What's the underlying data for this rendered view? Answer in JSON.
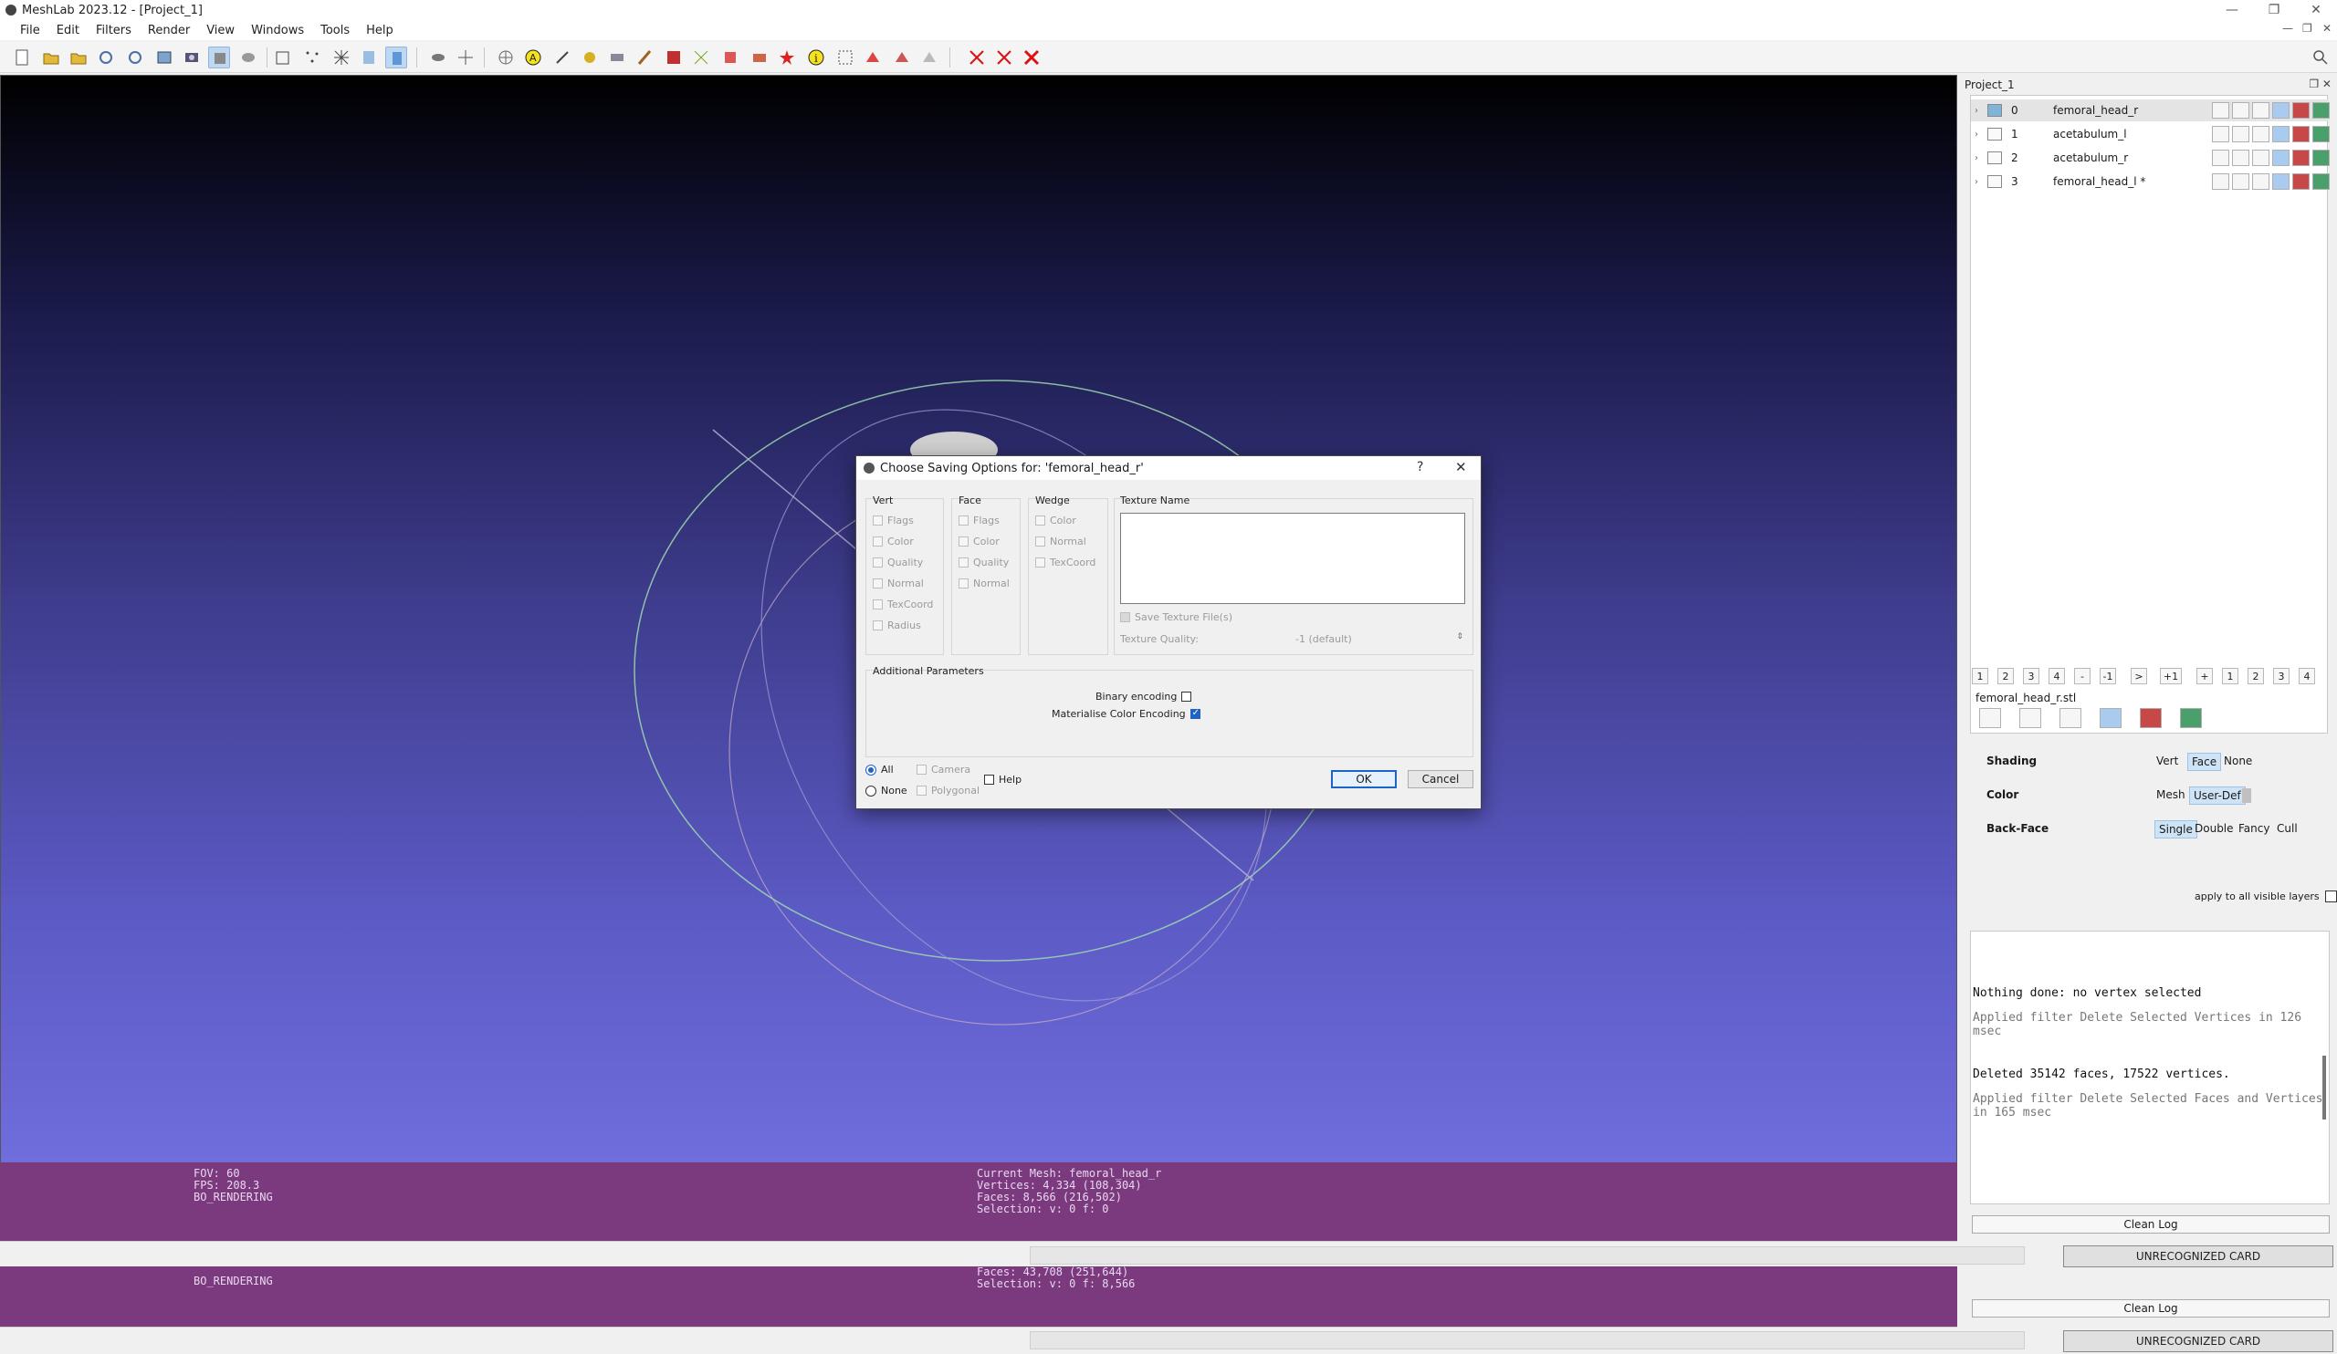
{
  "window": {
    "title": "MeshLab 2023.12 - [Project_1]"
  },
  "menu": [
    "File",
    "Edit",
    "Filters",
    "Render",
    "View",
    "Windows",
    "Tools",
    "Help"
  ],
  "viewport": {
    "left_info": [
      "FOV: 60",
      "FPS:   208.3",
      "BO_RENDERING"
    ],
    "right_info": [
      "Current Mesh: femoral_head_r",
      "Vertices: 4,334    (108,304)",
      "Faces: 8,566    (216,502)",
      "Selection: v: 0 f: 0"
    ],
    "left_info2": [
      "BO_RENDERING"
    ],
    "right_info2": [
      "Faces: 43,708    (251,644)",
      "Selection: v: 0 f: 8,566"
    ],
    "card_button": "UNRECOGNIZED CARD"
  },
  "dock": {
    "title": "Project_1",
    "layers": [
      {
        "index": "0",
        "name": "femoral_head_r",
        "selected": true
      },
      {
        "index": "1",
        "name": "acetabulum_l",
        "selected": false
      },
      {
        "index": "2",
        "name": "acetabulum_r",
        "selected": false
      },
      {
        "index": "3",
        "name": "femoral_head_l *",
        "selected": false
      }
    ],
    "number_buttons": [
      "1",
      "2",
      "3",
      "4",
      "-",
      "-1",
      ">",
      "+1",
      "+",
      "1",
      "2",
      "3",
      "4"
    ],
    "current_mesh": "femoral_head_r.stl",
    "shading": {
      "label": "Shading",
      "options": [
        "Vert",
        "Face",
        "None"
      ],
      "selected": "Face"
    },
    "color": {
      "label": "Color",
      "options": [
        "Mesh",
        "User-Def"
      ],
      "selected": "User-Def"
    },
    "backface": {
      "label": "Back-Face",
      "options": [
        "Single",
        "Double",
        "Fancy",
        "Cull"
      ],
      "selected": "Single"
    },
    "apply_all": "apply to all visible layers",
    "log": [
      {
        "text": "Nothing done: no vertex selected",
        "style": "strong"
      },
      {
        "text": "Applied filter Delete Selected Vertices in 126 msec",
        "style": "muted"
      },
      {
        "text": "Deleted 35142 faces, 17522 vertices.",
        "style": "strong"
      },
      {
        "text": "Applied filter Delete Selected Faces and Vertices in 165 msec",
        "style": "muted"
      }
    ],
    "clean_log": "Clean Log"
  },
  "dialog": {
    "title": "Choose Saving Options for: 'femoral_head_r'",
    "help_glyph": "?",
    "close_glyph": "✕",
    "vert": {
      "label": "Vert",
      "items": [
        "Flags",
        "Color",
        "Quality",
        "Normal",
        "TexCoord",
        "Radius"
      ]
    },
    "face": {
      "label": "Face",
      "items": [
        "Flags",
        "Color",
        "Quality",
        "Normal"
      ]
    },
    "wedge": {
      "label": "Wedge",
      "items": [
        "Color",
        "Normal",
        "TexCoord"
      ]
    },
    "texture_name_label": "Texture Name",
    "save_texture": "Save Texture File(s)",
    "texture_quality_label": "Texture Quality:",
    "texture_quality_value": "-1 (default)",
    "additional_label": "Additional Parameters",
    "binary_encoding": "Binary encoding",
    "materialise_color": "Materialise Color Encoding",
    "radio_all": "All",
    "radio_none": "None",
    "camera": "Camera",
    "polygonal": "Polygonal",
    "help": "Help",
    "ok": "OK",
    "cancel": "Cancel"
  }
}
